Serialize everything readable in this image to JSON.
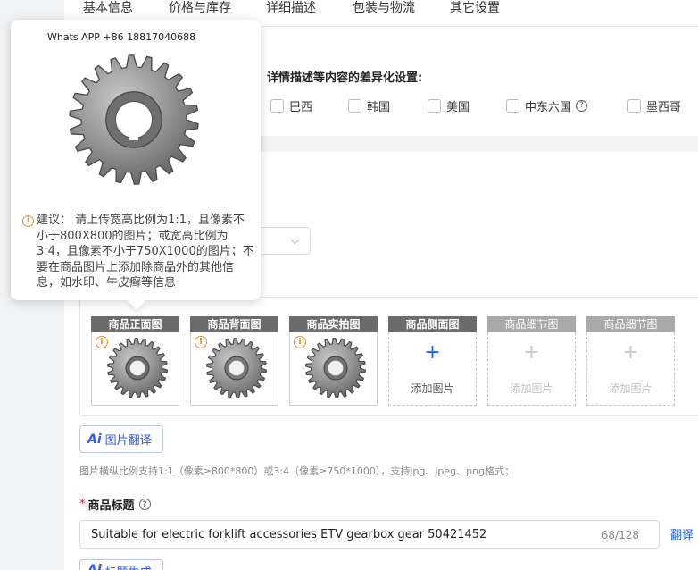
{
  "tabs": {
    "basic": "基本信息",
    "price_stock": "价格与库存",
    "detail_desc": "详细描述",
    "package_logistics": "包装与物流",
    "other": "其它设置"
  },
  "country_settings": {
    "title": "详情描述等内容的差异化设置:",
    "countries": [
      "巴西",
      "韩国",
      "美国",
      "中东六国",
      "墨西哥"
    ]
  },
  "image_slots": [
    {
      "header": "商品正面图",
      "state": "filled"
    },
    {
      "header": "商品背面图",
      "state": "filled"
    },
    {
      "header": "商品实拍图",
      "state": "filled"
    },
    {
      "header": "商品侧面图",
      "state": "empty",
      "add_label": "添加图片"
    },
    {
      "header": "商品细节图",
      "state": "disabled",
      "add_label": "添加图片"
    },
    {
      "header": "商品细节图",
      "state": "disabled",
      "add_label": "添加图片"
    }
  ],
  "image_translate_button": {
    "icon_text": "Ai",
    "label": "图片翻译"
  },
  "image_hint": "图片横纵比例支持1:1（像素≥800*800）或3:4（像素≥750*1000），支持jpg、jpeg、png格式；",
  "title_field": {
    "label": "商品标题",
    "value": "Suitable for electric forklift accessories ETV gearbox gear 50421452",
    "count": "68/128",
    "translate_link": "翻译"
  },
  "title_generate_button": {
    "icon_text": "Ai",
    "label": "标题生成"
  },
  "popover": {
    "caption": "Whats APP +86 18817040688",
    "warning": "建议： 请上传宽高比例为1:1，且像素不小于800X800的图片；或宽高比例为3:4，且像素不小于750X1000的图片；不要在商品图片上添加除商品外的其他信息，如水印、牛皮癣等信息"
  },
  "colors": {
    "accent": "#1a66ff",
    "ai_blue": "#2f5bea",
    "warning_orange": "#e8912c",
    "slot_header": "#6b6b6b",
    "required_red": "#e02020"
  },
  "icons": {
    "help": "question-circle-icon",
    "warn": "info-circle-icon",
    "add": "plus-icon",
    "select": "chevron-down-icon"
  }
}
